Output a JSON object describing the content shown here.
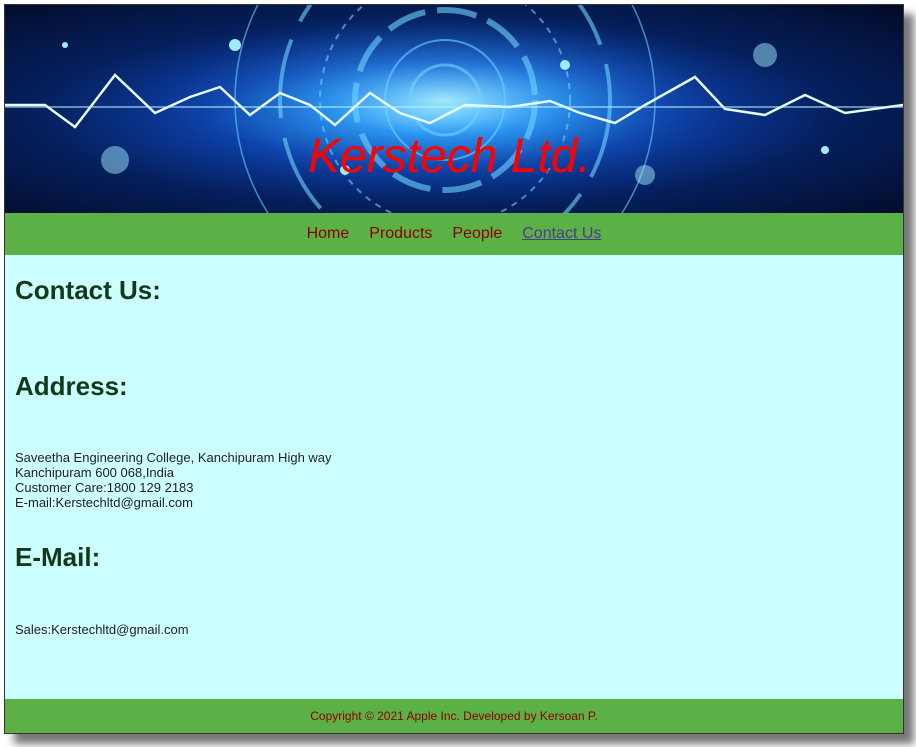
{
  "header": {
    "title": "Kerstech Ltd."
  },
  "nav": {
    "items": [
      {
        "label": "Home"
      },
      {
        "label": "Products"
      },
      {
        "label": "People"
      },
      {
        "label": "Contact Us"
      }
    ],
    "active": "Contact Us"
  },
  "main": {
    "contact_heading": "Contact Us:",
    "address_heading": "Address:",
    "address_lines": [
      "Saveetha Engineering College, Kanchipuram High way",
      "Kanchipuram 600 068,India",
      "Customer Care:1800 129 2183",
      "E-mail:Kerstechltd@gmail.com"
    ],
    "email_heading": "E-Mail:",
    "email_line": "Sales:Kerstechltd@gmail.com"
  },
  "footer": {
    "text": "Copyright © 2021 Apple Inc. Developed by Kersoan P."
  },
  "colors": {
    "nav_bg": "#5bb146",
    "content_bg": "#ccffff",
    "title_red": "#ff0000",
    "link_dark_red": "#8b0000",
    "heading_green": "#14391a"
  }
}
